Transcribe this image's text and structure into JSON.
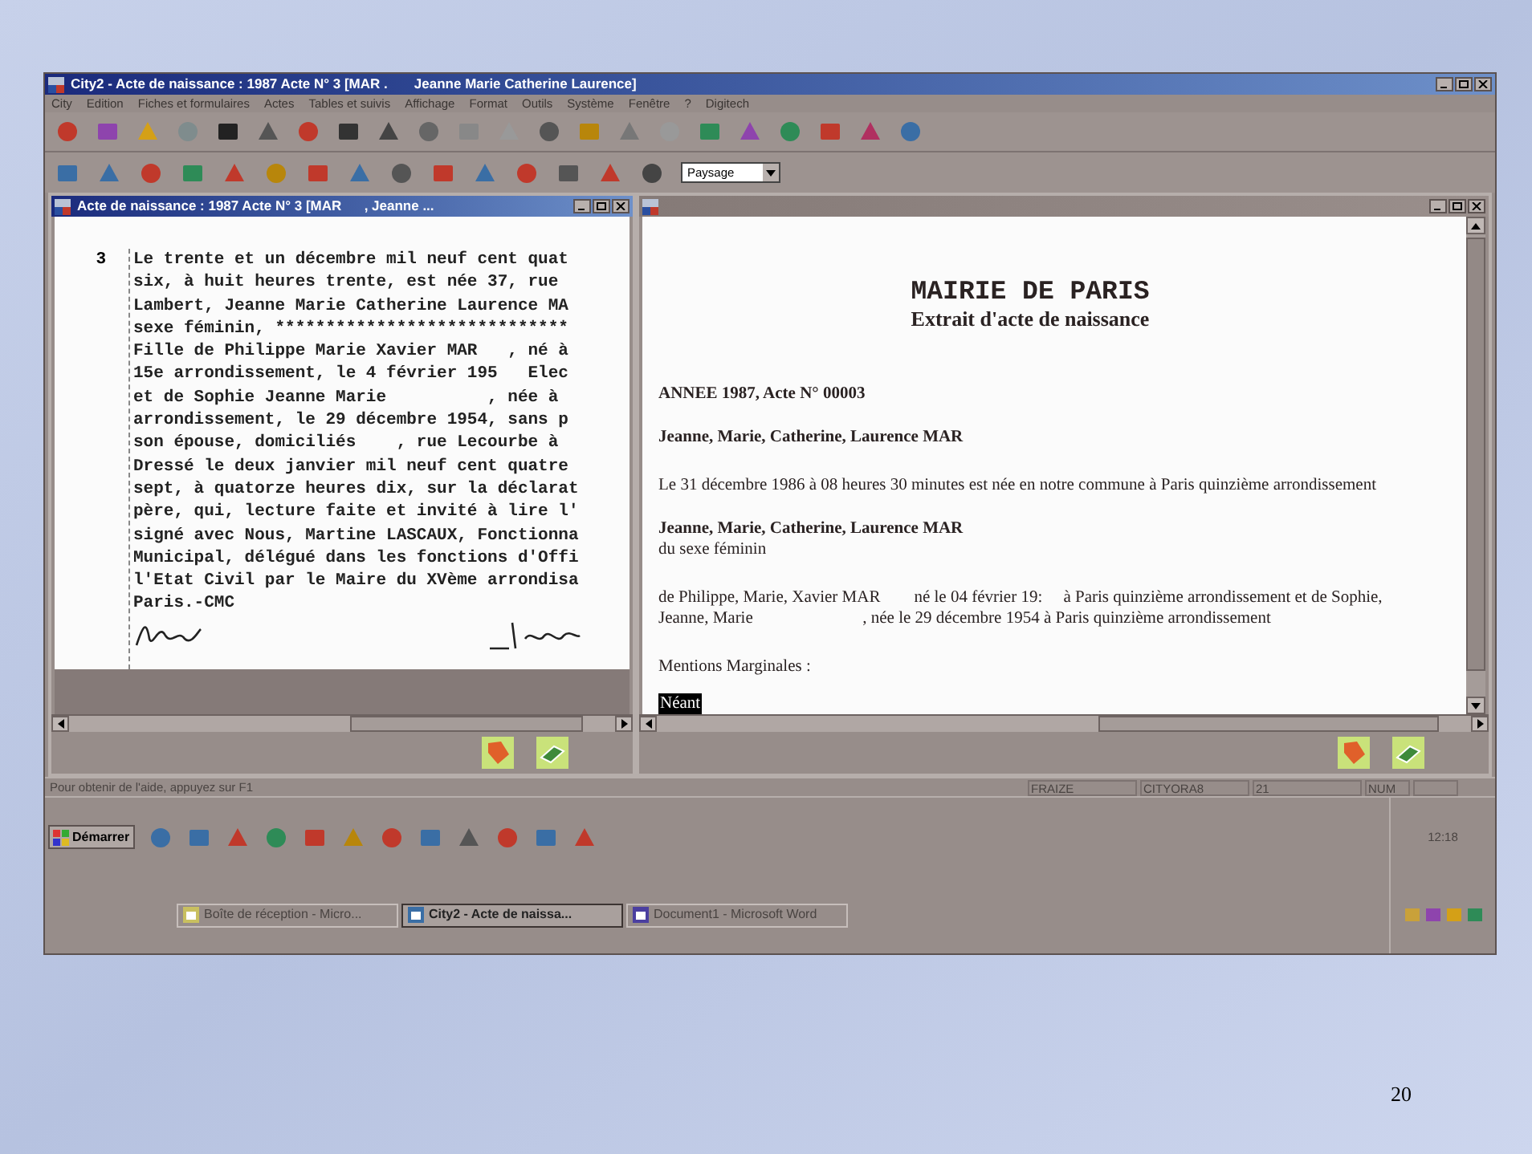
{
  "slide": {
    "page_number": "20"
  },
  "window": {
    "title": "City2 - Acte de naissance : 1987 Acte N° 3 [MAR .       Jeanne Marie Catherine Laurence]",
    "active": true
  },
  "menu": [
    "City",
    "Edition",
    "Fiches et formulaires",
    "Actes",
    "Tables et suivis",
    "Affichage",
    "Format",
    "Outils",
    "Système",
    "Fenêtre",
    "?",
    "Digitech"
  ],
  "toolbar": {
    "combo": {
      "value": "Paysage"
    }
  },
  "left_window": {
    "title": "Acte de naissance : 1987 Acte N° 3 [MAR      , Jeanne ...",
    "active": true,
    "line_number": "3",
    "lines": [
      "Le trente et un décembre mil neuf cent quat",
      "six, à huit heures trente, est née 37, rue",
      "Lambert, Jeanne Marie Catherine Laurence MA",
      "sexe féminin, *****************************",
      "Fille de Philippe Marie Xavier MAR   , né à",
      "15e arrondissement, le 4 février 195   Elec",
      "et de Sophie Jeanne Marie          , née à",
      "arrondissement, le 29 décembre 1954, sans p",
      "son épouse, domiciliés    , rue Lecourbe à",
      "Dressé le deux janvier mil neuf cent quatre",
      "sept, à quatorze heures dix, sur la déclarat",
      "père, qui, lecture faite et invité à lire l'",
      "signé avec Nous, Martine LASCAUX, Fonctionna",
      "Municipal, délégué dans les fonctions d'Offi",
      "l'Etat Civil par le Maire du XVème arrondisa",
      "Paris.-CMC"
    ]
  },
  "right_window": {
    "active": false,
    "heading": "MAIRIE DE PARIS",
    "subheading": "Extrait d'acte de naissance",
    "paragraphs": [
      {
        "kind": "bold",
        "text": "ANNEE 1987, Acte N° 00003"
      },
      {
        "kind": "bold",
        "text": "Jeanne, Marie, Catherine, Laurence MAR"
      },
      {
        "kind": "plain",
        "text": "Le 31 décembre 1986 à 08 heures 30 minutes est née en notre commune à Paris quinzième arrondissement"
      },
      {
        "kind": "bold",
        "text": "Jeanne, Marie, Catherine, Laurence MAR"
      },
      {
        "kind": "continued",
        "text": "du sexe féminin"
      },
      {
        "kind": "plain",
        "text": "de Philippe, Marie, Xavier MAR        né le 04 février 19:     à Paris quinzième arrondissement et de Sophie, Jeanne, Marie                          , née le 29 décembre 1954 à Paris quinzième arrondissement"
      },
      {
        "kind": "plain",
        "text": "Mentions Marginales :"
      },
      {
        "kind": "highlight",
        "text": "Néant"
      }
    ]
  },
  "status_bar": {
    "hint": "Pour obtenir de l'aide, appuyez sur F1",
    "panes": [
      "FRAIZE",
      "CITYORA8",
      "21",
      "NUM"
    ]
  },
  "taskbar": {
    "start": "Démarrer",
    "tasks": [
      {
        "label": "Boîte de réception - Micro...",
        "selected": false
      },
      {
        "label": "City2 - Acte de naissa...",
        "selected": true
      },
      {
        "label": "Document1 - Microsoft Word",
        "selected": false
      }
    ],
    "clock": "12:18"
  }
}
